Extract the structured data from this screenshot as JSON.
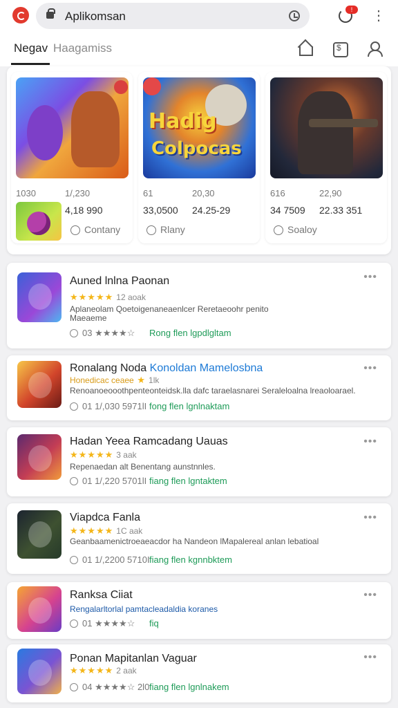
{
  "header": {
    "url": "Aplikomsan",
    "notification_count": "!"
  },
  "tabs": [
    {
      "label": "Negav"
    },
    {
      "label": "Haagamiss"
    }
  ],
  "featured": [
    {
      "row1a": "1030",
      "row1b": "1/,230",
      "row2a": "4,18 990",
      "row2b": "",
      "like": "Contany",
      "art_title": ""
    },
    {
      "row1a": "61",
      "row1b": "20,30",
      "row2a": "33,0500",
      "row2b": "24.25-29",
      "like": "Rlany",
      "art_title_1": "Hadig",
      "art_title_2": "Colpocas"
    },
    {
      "row1a": "616",
      "row1b": "22,90",
      "row2a": "34 7509",
      "row2b": "22.33 351",
      "like": "Soaloy"
    }
  ],
  "apps": [
    {
      "title": "Auned lnlna Paonan",
      "title_accent": "",
      "stars": "★★★★★",
      "rating": "12 aoak",
      "desc1": "Aplaneolam Qoetoigenaneaenlcer Reretaeoohr penito",
      "desc2": "Maeaeme",
      "meta": "03 ★★★★☆",
      "action": "Rong flen lgpdlgltam"
    },
    {
      "title": "Ronalang Noda ",
      "title_accent": "Konoldan Mamelosbna",
      "stars": "★",
      "stars_prefix": "Honedicac ceaee",
      "rating": "1lk",
      "desc1": "Renoanoeooothpenteonteidsk.lla dafc taraelasnarei Seraleloalna lreaoloarael.",
      "meta": "01 1/,030 5971lI",
      "action": "fong flen lgnlnaktam"
    },
    {
      "title": "Hadan Yeea Ramcadang Uauas",
      "title_accent": "",
      "stars": "★★★★★",
      "rating": "3 aak",
      "desc1": "Repenaedan alt Benentang aunstnnles.",
      "meta": "01 1/,220 5701lI",
      "action": "fiang flen lgntaktem"
    },
    {
      "title": "Viapdca Fanla",
      "title_accent": "",
      "stars": "★★★★★",
      "rating": "1C aak",
      "desc1": "Geanbaamenictroeaeacdor ha Nandeon lMapalereal anlan lebatioal",
      "meta": "01 1/,2200 5710I",
      "action": "fiang flen kgnnbktem"
    },
    {
      "title": "Ranksa Ciiat",
      "title_accent": "",
      "stars": "★★★★☆",
      "rating": "",
      "desc1": "Rengalarltorlal pamtacleadaldia koranes",
      "meta": "01 ★★★★☆",
      "action": "fiq"
    },
    {
      "title": "Ponan Mapitanlan Vaguar",
      "title_accent": "",
      "stars": "★★★★★",
      "rating": "2 aak",
      "desc1": "",
      "meta": "04 ★★★★☆ 2l0",
      "action": "fiang flen lgnlnakem"
    }
  ],
  "colors": {
    "accent_red": "#e23a2e",
    "star_yellow": "#f4b619",
    "action_green": "#1e9b58",
    "link_blue": "#1d7ad6"
  },
  "icons": [
    "app-logo-icon",
    "lock-icon",
    "history-icon",
    "notification-icon",
    "more-icon",
    "home-icon",
    "store-icon",
    "user-icon",
    "heart-icon"
  ]
}
